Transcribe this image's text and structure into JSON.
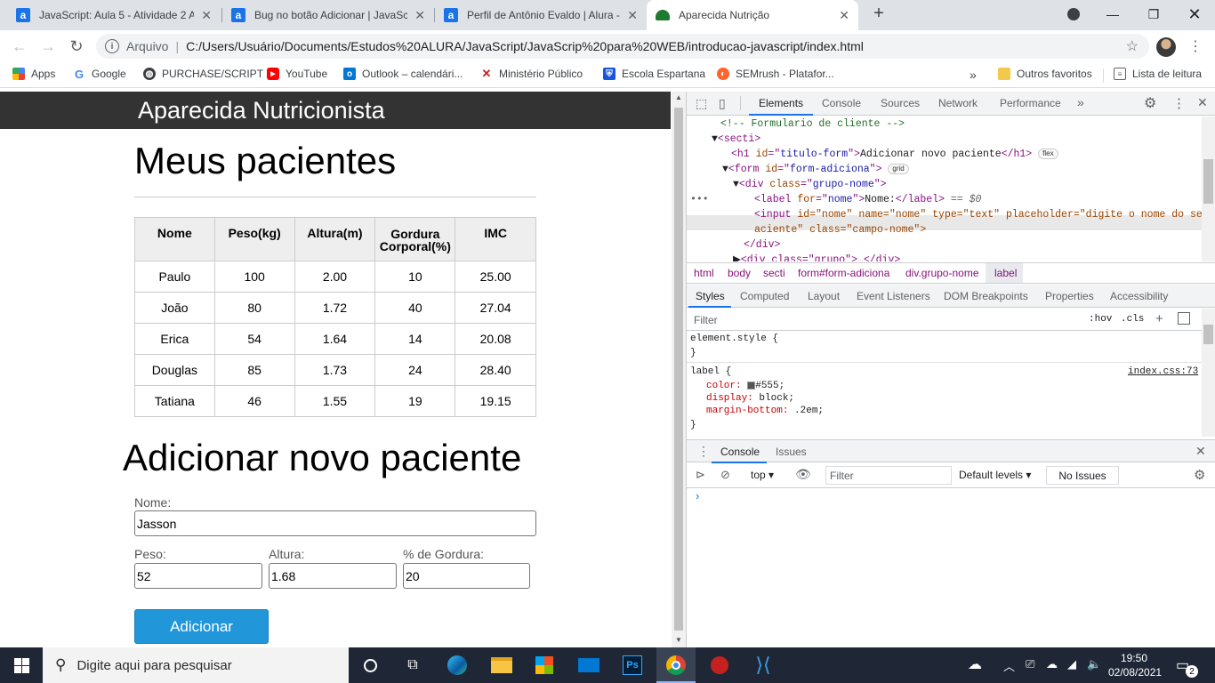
{
  "browser": {
    "tabs": [
      {
        "title": "JavaScript: Aula 5 - Atividade 2 A",
        "icon": "a"
      },
      {
        "title": "Bug no botão Adicionar | JavaScr",
        "icon": "a"
      },
      {
        "title": "Perfil de Antônio Evaldo | Alura -",
        "icon": "a"
      },
      {
        "title": "Aparecida Nutrição",
        "icon": "leaf"
      }
    ],
    "new_tab": "+",
    "address": {
      "scheme": "Arquivo",
      "separator": "|",
      "url": "C:/Users/Usuário/Documents/Estudos%20ALURA/JavaScript/JavaScrip%20para%20WEB/introducao-javascript/index.html"
    },
    "bookmarks": [
      {
        "label": "Apps",
        "icon": "apps-icon"
      },
      {
        "label": "Google",
        "icon": "google-icon"
      },
      {
        "label": "PURCHASE/SCRIPT",
        "icon": "globe-icon"
      },
      {
        "label": "YouTube",
        "icon": "youtube-icon"
      },
      {
        "label": "Outlook – calendári...",
        "icon": "outlook-icon"
      },
      {
        "label": "Ministério Público",
        "icon": "mp-icon"
      },
      {
        "label": "Escola Espartana",
        "icon": "shield-icon"
      },
      {
        "label": "SEMrush - Platafor...",
        "icon": "semrush-icon"
      }
    ],
    "bookmarks_overflow": "»",
    "other_favorites": "Outros favoritos",
    "reading_list": "Lista de leitura"
  },
  "page": {
    "header_title": "Aparecida Nutricionista",
    "patients_title": "Meus pacientes",
    "table": {
      "headers": [
        "Nome",
        "Peso(kg)",
        "Altura(m)",
        "Gordura Corporal(%)",
        "IMC"
      ],
      "rows": [
        [
          "Paulo",
          "100",
          "2.00",
          "10",
          "25.00"
        ],
        [
          "João",
          "80",
          "1.72",
          "40",
          "27.04"
        ],
        [
          "Erica",
          "54",
          "1.64",
          "14",
          "20.08"
        ],
        [
          "Douglas",
          "85",
          "1.73",
          "24",
          "28.40"
        ],
        [
          "Tatiana",
          "46",
          "1.55",
          "19",
          "19.15"
        ]
      ]
    },
    "form": {
      "title": "Adicionar novo paciente",
      "nome_label": "Nome:",
      "nome_value": "Jasson",
      "peso_label": "Peso:",
      "peso_value": "52",
      "altura_label": "Altura:",
      "altura_value": "1.68",
      "gordura_label": "% de Gordura:",
      "gordura_value": "20",
      "submit": "Adicionar"
    }
  },
  "devtools": {
    "tabs": [
      "Elements",
      "Console",
      "Sources",
      "Network",
      "Performance"
    ],
    "more": "»",
    "dom_lines": {
      "l1": "<!-- Formulario de cliente -->",
      "l2_tag": "secti",
      "l3_id": "titulo-form",
      "l3_text": "Adicionar novo paciente",
      "l3_badge": "flex",
      "l4_id": "form-adiciona",
      "l4_badge": "grid",
      "l5_class": "grupo-nome",
      "l6_for": "nome",
      "l6_text": "Nome:",
      "l6_suffix": "== $0",
      "l7_attrs": "id=\"nome\" name=\"nome\" type=\"text\" placeholder=\"digite o nome do seu p",
      "l8_cont": "aciente\" class=\"campo-nome\">",
      "l9": "</div>",
      "l10": "<div class=\"grupo\">…</div>"
    },
    "breadcrumbs": [
      "html",
      "body",
      "secti",
      "form#form-adiciona",
      "div.grupo-nome",
      "label"
    ],
    "side_tabs": [
      "Styles",
      "Computed",
      "Layout",
      "Event Listeners",
      "DOM Breakpoints",
      "Properties",
      "Accessibility"
    ],
    "filter_placeholder": "Filter",
    "hov": ":hov",
    "cls": ".cls",
    "styles": {
      "element_style": "element.style {",
      "close": "}",
      "rule_selector": "label {",
      "source": "index.css:73",
      "color_prop": "color:",
      "color_value": "#555;",
      "color_swatch": "#555555",
      "display_prop": "display:",
      "display_value": "block;",
      "margin_prop": "margin-bottom:",
      "margin_value": ".2em;"
    },
    "drawer_tabs": [
      "Console",
      "Issues"
    ],
    "console": {
      "context": "top",
      "filter": "Filter",
      "levels": "Default levels",
      "issues": "No Issues",
      "prompt": "›"
    }
  },
  "taskbar": {
    "search_placeholder": "Digite aqui para pesquisar",
    "time": "19:50",
    "date": "02/08/2021",
    "notifications": "2"
  }
}
